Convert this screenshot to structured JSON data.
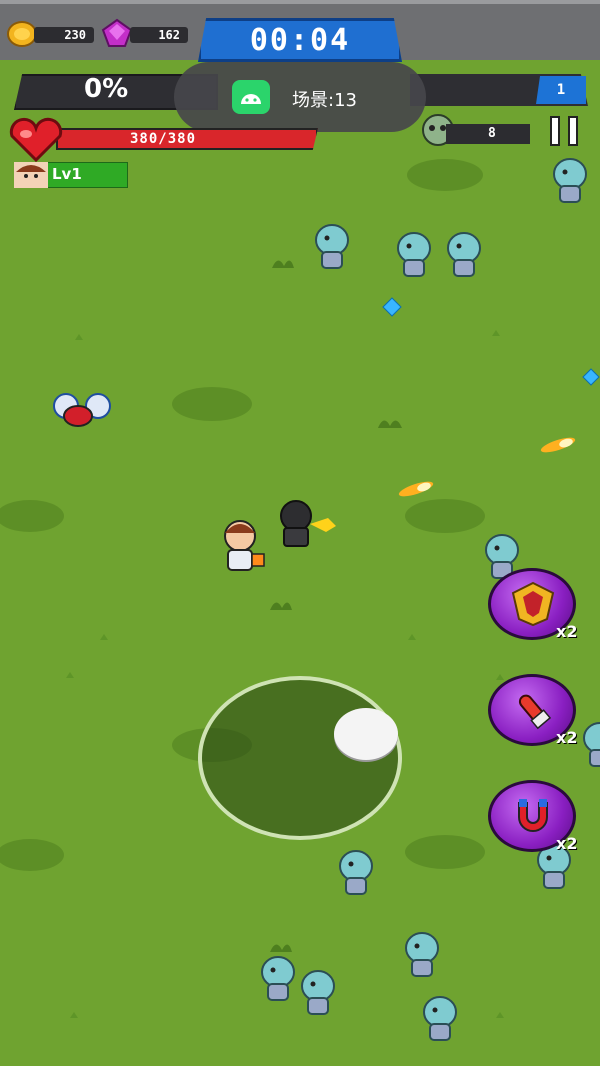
{
  "resources": {
    "coins": "230",
    "gems": "162"
  },
  "timer": "00:04",
  "progress": {
    "percent_text": "0%",
    "level_number": "1"
  },
  "toast": {
    "text": "场景:13"
  },
  "player": {
    "hp_text": "380/380",
    "level_label": "Lv1"
  },
  "kills": "8",
  "skills": [
    {
      "name": "shield",
      "multiplier": "x2"
    },
    {
      "name": "rocket",
      "multiplier": "x2"
    },
    {
      "name": "magnet",
      "multiplier": "x2"
    }
  ],
  "colors": {
    "grass": "#6fa330",
    "hp": "#d9262b",
    "timer": "#1f6fd1",
    "skill": "#8a1fc2"
  }
}
